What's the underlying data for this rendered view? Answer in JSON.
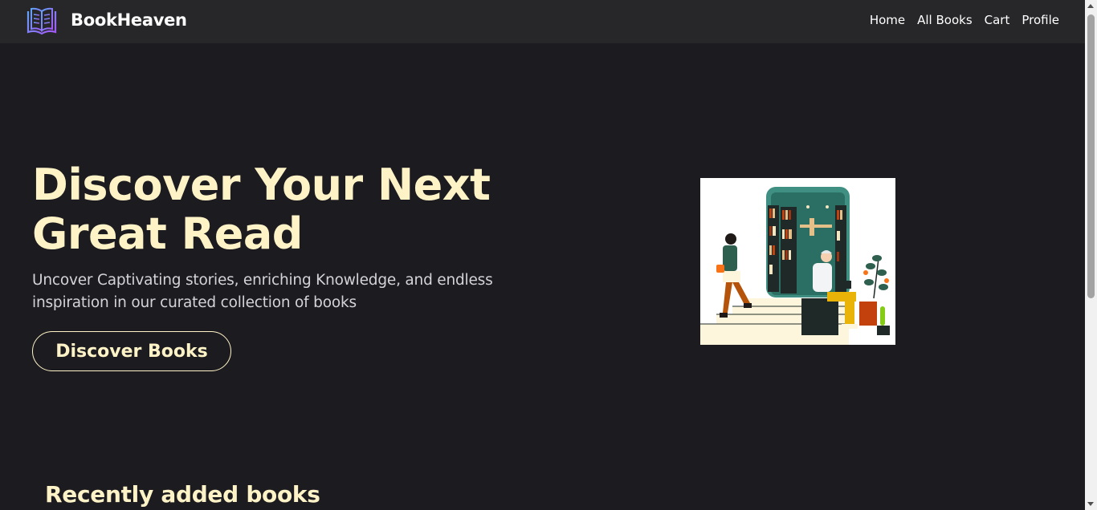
{
  "navbar": {
    "brand": "BookHeaven",
    "logo_icon": "open-book-icon",
    "links": [
      "Home",
      "All Books",
      "Cart",
      "Profile"
    ]
  },
  "hero": {
    "title": "Discover Your Next Great Read",
    "subtitle": "Uncover Captivating stories, enriching Knowledge, and endless inspiration in our curated collection of books",
    "button_label": "Discover Books",
    "illustration": "library-reading-illustration"
  },
  "recent": {
    "title": "Recently added books"
  },
  "colors": {
    "background": "#1c1b1f",
    "navbar": "#27272a",
    "accent": "#fef3c7",
    "text_muted": "#d4d4d8"
  }
}
